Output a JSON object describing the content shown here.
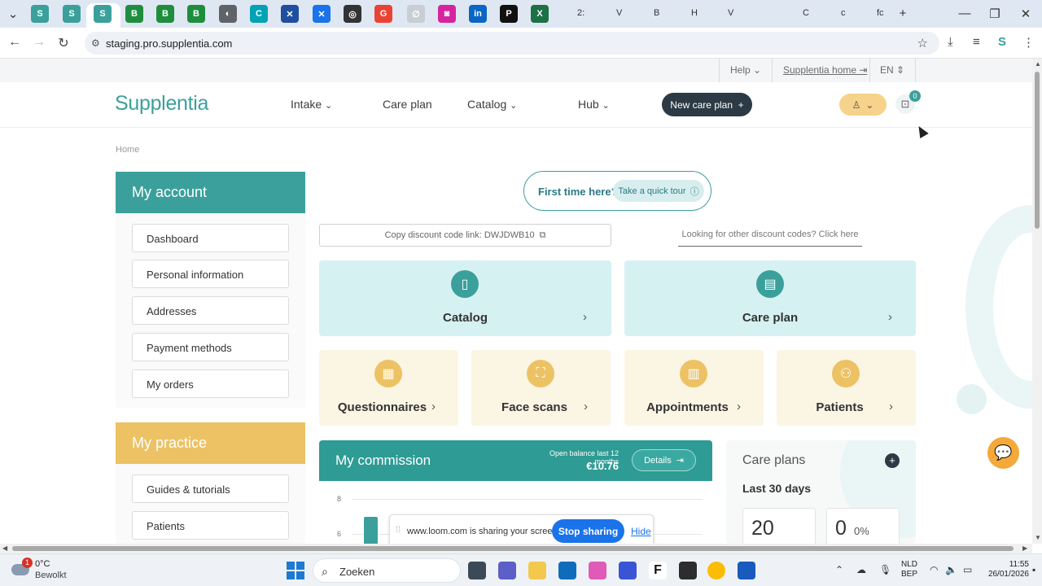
{
  "browser": {
    "url": "staging.pro.supplentia.com",
    "tabs": [
      {
        "icon": "supplentia-icon",
        "color": "#3ba09b",
        "glyph": "S"
      },
      {
        "icon": "supplentia-icon",
        "color": "#3ba09b",
        "glyph": "S"
      },
      {
        "icon": "supplentia-icon",
        "color": "#3ba09b",
        "glyph": "S"
      },
      {
        "icon": "b-icon",
        "color": "#1e8e3e",
        "glyph": "B"
      },
      {
        "icon": "b-icon",
        "color": "#1e8e3e",
        "glyph": "B"
      },
      {
        "icon": "b-icon",
        "color": "#1e8e3e",
        "glyph": "B"
      },
      {
        "icon": "globe-icon",
        "color": "#5f6368",
        "glyph": "◐"
      },
      {
        "icon": "c-icon",
        "color": "#00a3b4",
        "glyph": "C"
      },
      {
        "icon": "x-icon",
        "color": "#1f4f9e",
        "glyph": "✕"
      },
      {
        "icon": "x-icon",
        "color": "#1a73e8",
        "glyph": "✕"
      },
      {
        "icon": "target-icon",
        "color": "#333333",
        "glyph": "◎"
      },
      {
        "icon": "google-icon",
        "color": "#ea4335",
        "glyph": "G"
      },
      {
        "icon": "blank-icon",
        "color": "#c9cdd4",
        "glyph": "∅"
      },
      {
        "icon": "instagram-icon",
        "color": "#d6249f",
        "glyph": "◙"
      },
      {
        "icon": "linkedin-icon",
        "color": "#0a66c2",
        "glyph": "in"
      },
      {
        "icon": "p-icon",
        "color": "#111111",
        "glyph": "P"
      },
      {
        "icon": "excel-icon",
        "color": "#1e7145",
        "glyph": "X"
      }
    ],
    "tab_texts": [
      "2:",
      "V",
      "B",
      "H",
      "V",
      "C",
      "c",
      "fc"
    ]
  },
  "utility": {
    "help": "Help",
    "home": "Supplentia home",
    "lang": "EN"
  },
  "header": {
    "logo": "Supplentia",
    "nav": [
      "Intake",
      "Care plan",
      "Catalog",
      "Hub"
    ],
    "new_care_plan": "New care plan",
    "cart_count": "0"
  },
  "breadcrumb": "Home",
  "sidebar": {
    "account_title": "My account",
    "account_items": [
      "Dashboard",
      "Personal information",
      "Addresses",
      "Payment methods",
      "My orders"
    ],
    "practice_title": "My practice",
    "practice_items": [
      "Guides & tutorials",
      "Patients"
    ]
  },
  "tour": {
    "label": "First time here?",
    "button": "Take a quick tour"
  },
  "discount": {
    "copy": "Copy discount code link: DWJDWB10",
    "other": "Looking for other discount codes? Click here"
  },
  "tiles": {
    "catalog": "Catalog",
    "care_plan": "Care plan",
    "questionnaires": "Questionnaires",
    "face_scans": "Face scans",
    "appointments": "Appointments",
    "patients": "Patients"
  },
  "commission": {
    "title": "My commission",
    "open_balance_label": "Open balance last 12 months",
    "open_balance_value": "€10.76",
    "details": "Details",
    "y_ticks": [
      "8",
      "6"
    ]
  },
  "care_plans": {
    "title": "Care plans",
    "period": "Last 30 days",
    "count": "20",
    "second": "0",
    "second_pct": "0%"
  },
  "loom": {
    "text": "www.loom.com is sharing your screen.",
    "stop": "Stop sharing",
    "hide": "Hide"
  },
  "taskbar": {
    "temp": "0°C",
    "weather": "Bewolkt",
    "weather_badge": "1",
    "search": "Zoeken",
    "lang_line1": "NLD",
    "lang_line2": "BEP",
    "time": "11:55",
    "date": "26/01/2026"
  },
  "colors": {
    "teal": "#3ba09b",
    "dark_teal": "#2e9b94",
    "yellow": "#ecc264",
    "light_teal": "#d6f1f1",
    "cream": "#fbf5e4",
    "navy": "#2b3a44"
  }
}
